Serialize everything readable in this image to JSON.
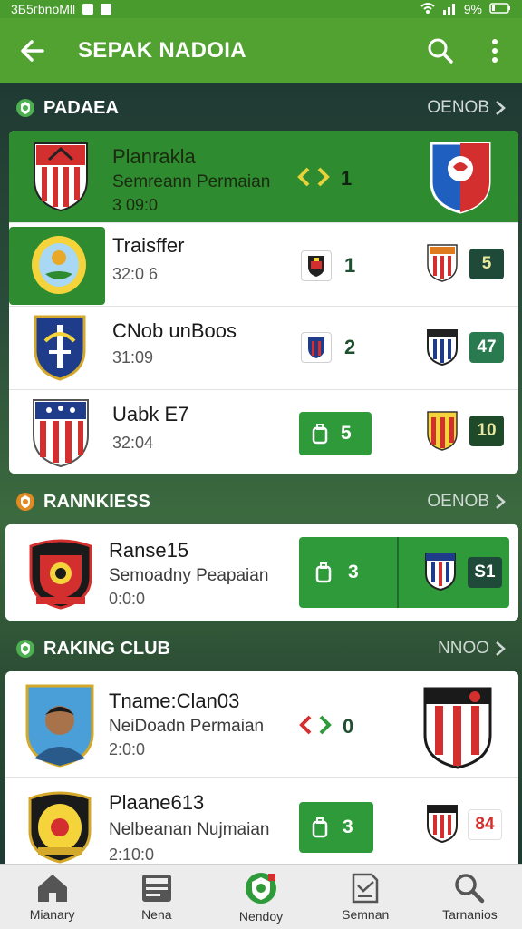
{
  "status_bar": {
    "left_text": "3Б5гbnoМll",
    "right_text": "9%"
  },
  "app_bar": {
    "title": "SEPAK NADOIA"
  },
  "sections": [
    {
      "title": "PADAEA",
      "more": "OENOB",
      "rows": [
        {
          "name": "Planrakla",
          "subtitle": "Semreann Permaian",
          "time": "3 09:0",
          "score_a": "1"
        },
        {
          "name": "Traisffer",
          "time": "32:0 6",
          "score_a": "1",
          "score_b": "5"
        },
        {
          "name": "CNob unBoos",
          "time": "31:09",
          "score_a": "2",
          "score_b": "47"
        },
        {
          "name": "Uabk E7",
          "time": "32:04",
          "score_a": "5",
          "score_b": "10"
        }
      ]
    },
    {
      "title": "RANNKIESS",
      "more": "OENOB",
      "rows": [
        {
          "name": "Ranse15",
          "subtitle": "Semoadny Peapaian",
          "time": "0:0:0",
          "score_a": "3",
          "score_b": "S1"
        }
      ]
    },
    {
      "title": "RAKING CLUB",
      "more": "NNOO",
      "rows": [
        {
          "name": "Tname:Clan03",
          "subtitle": "NeiDoadn Permaian",
          "time": "2:0:0",
          "score_a": "0"
        },
        {
          "name": "Plaane613",
          "subtitle": "Nelbeanan Nujmaian",
          "time": "2:10:0",
          "score_a": "3",
          "score_b": "84"
        }
      ]
    }
  ],
  "bottom_nav": [
    {
      "label": "Mianary",
      "icon": "home-icon"
    },
    {
      "label": "Nena",
      "icon": "news-icon"
    },
    {
      "label": "Nendoy",
      "icon": "shield-logo-icon"
    },
    {
      "label": "Semnan",
      "icon": "document-icon"
    },
    {
      "label": "Tarnanios",
      "icon": "search-icon"
    }
  ],
  "colors": {
    "brand_green": "#52a231",
    "row_green": "#2e8b2f",
    "button_green": "#2e9a3a",
    "badge_red": "#d32f2f",
    "badge_dark": "#1f4a3a"
  }
}
